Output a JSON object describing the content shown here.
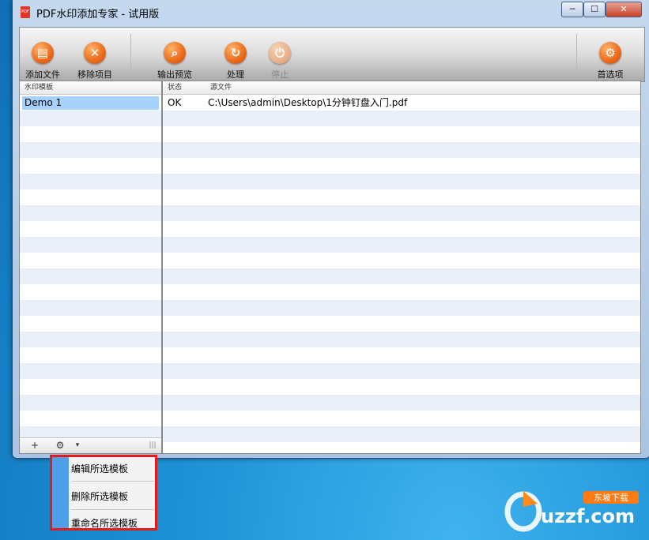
{
  "window": {
    "title": "PDF水印添加专家 - 试用版",
    "app_icon_text": "PDF",
    "controls": {
      "minimize": "─",
      "maximize": "☐",
      "close": "✕"
    }
  },
  "toolbar": {
    "add_file": "添加文件",
    "remove_item": "移除项目",
    "output_preview": "输出预览",
    "process": "处理",
    "stop": "停止",
    "preferences": "首选项"
  },
  "left_panel": {
    "header": "水印模板",
    "items": [
      "Demo 1"
    ],
    "footer": {
      "add": "+",
      "settings": "⚙",
      "dropdown": "▾",
      "grip": "|||"
    }
  },
  "right_panel": {
    "columns": {
      "status": "状态",
      "source": "源文件"
    },
    "rows": [
      {
        "status": "OK",
        "source": "C:\\Users\\admin\\Desktop\\1分钟钉盘入门.pdf"
      }
    ]
  },
  "context_menu": {
    "items": [
      "编辑所选模板",
      "删除所选模板",
      "重命名所选模板"
    ]
  },
  "watermark": {
    "brand": "uzzf.com",
    "tag": "东坡下载"
  },
  "colors": {
    "accent_orange": "#ea6a1a",
    "selection": "#a8d1fb",
    "menu_strip": "#4f9ee8",
    "highlight_border": "#e31b1b"
  }
}
